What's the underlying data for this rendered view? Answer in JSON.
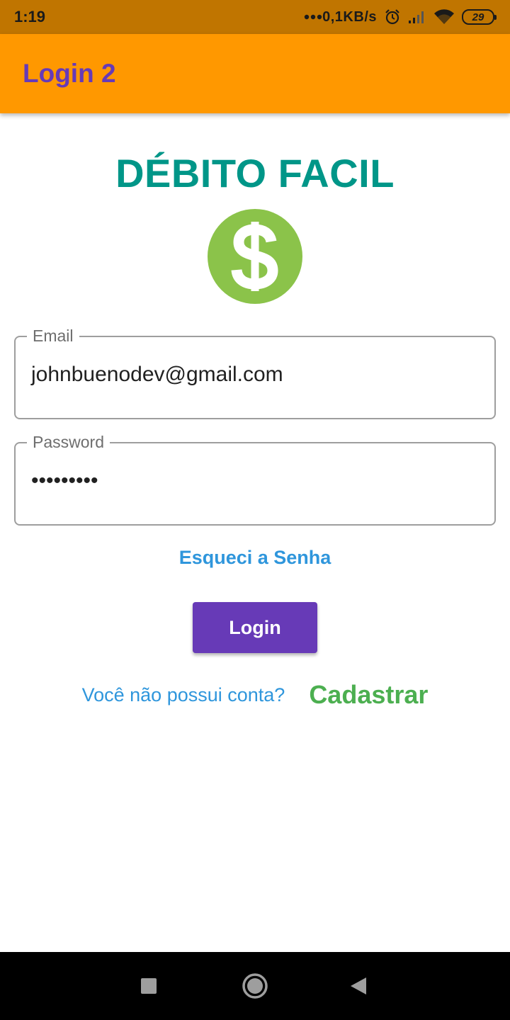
{
  "status_bar": {
    "time": "1:19",
    "network_speed": "0,1KB/s",
    "battery_level": "29",
    "icons": [
      "more-dots-icon",
      "alarm-icon",
      "signal-icon",
      "wifi-icon",
      "battery-icon"
    ]
  },
  "app_bar": {
    "title": "Login 2",
    "background_color": "#ff9800",
    "title_color": "#673ab7"
  },
  "brand": {
    "title": "DÉBITO FACIL",
    "logo_icon": "dollar-icon",
    "title_color": "#009688",
    "logo_color": "#8bc34a"
  },
  "form": {
    "email": {
      "label": "Email",
      "value": "johnbuenodev@gmail.com"
    },
    "password": {
      "label": "Password",
      "value": "•••••••••"
    },
    "forgot_password": "Esqueci a Senha",
    "login_button": "Login",
    "signup_question": "Você não possui conta?",
    "signup_link": "Cadastrar"
  },
  "colors": {
    "primary": "#673ab7",
    "link": "#2f96dc",
    "signup": "#4caf50"
  },
  "nav_bar": {
    "icons": [
      "recents-icon",
      "home-icon",
      "back-icon"
    ]
  }
}
